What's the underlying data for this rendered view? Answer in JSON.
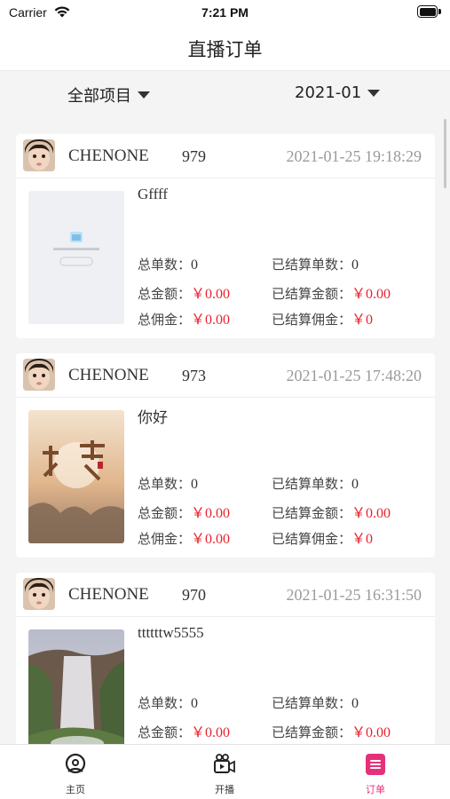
{
  "status_bar": {
    "carrier": "Carrier",
    "time": "7:21 PM"
  },
  "navbar": {
    "title": "直播订单"
  },
  "filters": {
    "project": "全部项目",
    "month": "2021-01"
  },
  "labels": {
    "total_orders": "总单数：",
    "total_amount": "总金额：",
    "total_commission": "总佣金：",
    "settled_orders": "已结算单数：",
    "settled_amount": "已结算金额：",
    "settled_commission": "已结算佣金："
  },
  "orders": [
    {
      "anchor": "CHENONE",
      "id": "979",
      "time": "2021-01-25 19:18:29",
      "goods": "Gffff",
      "thumb": "blank-page-image",
      "total_orders": "0",
      "total_amount": "￥0.00",
      "total_commission": "￥0.00",
      "settled_orders": "0",
      "settled_amount": "￥0.00",
      "settled_commission": "￥0"
    },
    {
      "anchor": "CHENONE",
      "id": "973",
      "time": "2021-01-25 17:48:20",
      "goods": "你好",
      "thumb": "poster-image",
      "total_orders": "0",
      "total_amount": "￥0.00",
      "total_commission": "￥0.00",
      "settled_orders": "0",
      "settled_amount": "￥0.00",
      "settled_commission": "￥0"
    },
    {
      "anchor": "CHENONE",
      "id": "970",
      "time": "2021-01-25 16:31:50",
      "goods": "ttttttw5555",
      "thumb": "waterfall-image",
      "total_orders": "0",
      "total_amount": "￥0.00",
      "settled_orders": "0",
      "settled_amount": "￥0.00"
    }
  ],
  "tabs": [
    {
      "label": "主页",
      "icon": "home-face-icon"
    },
    {
      "label": "开播",
      "icon": "live-camera-icon"
    },
    {
      "label": "订单",
      "icon": "order-list-icon"
    }
  ],
  "colors": {
    "accent": "#e5307a",
    "money": "#e8212e",
    "time_gray": "#9a9a9a"
  }
}
